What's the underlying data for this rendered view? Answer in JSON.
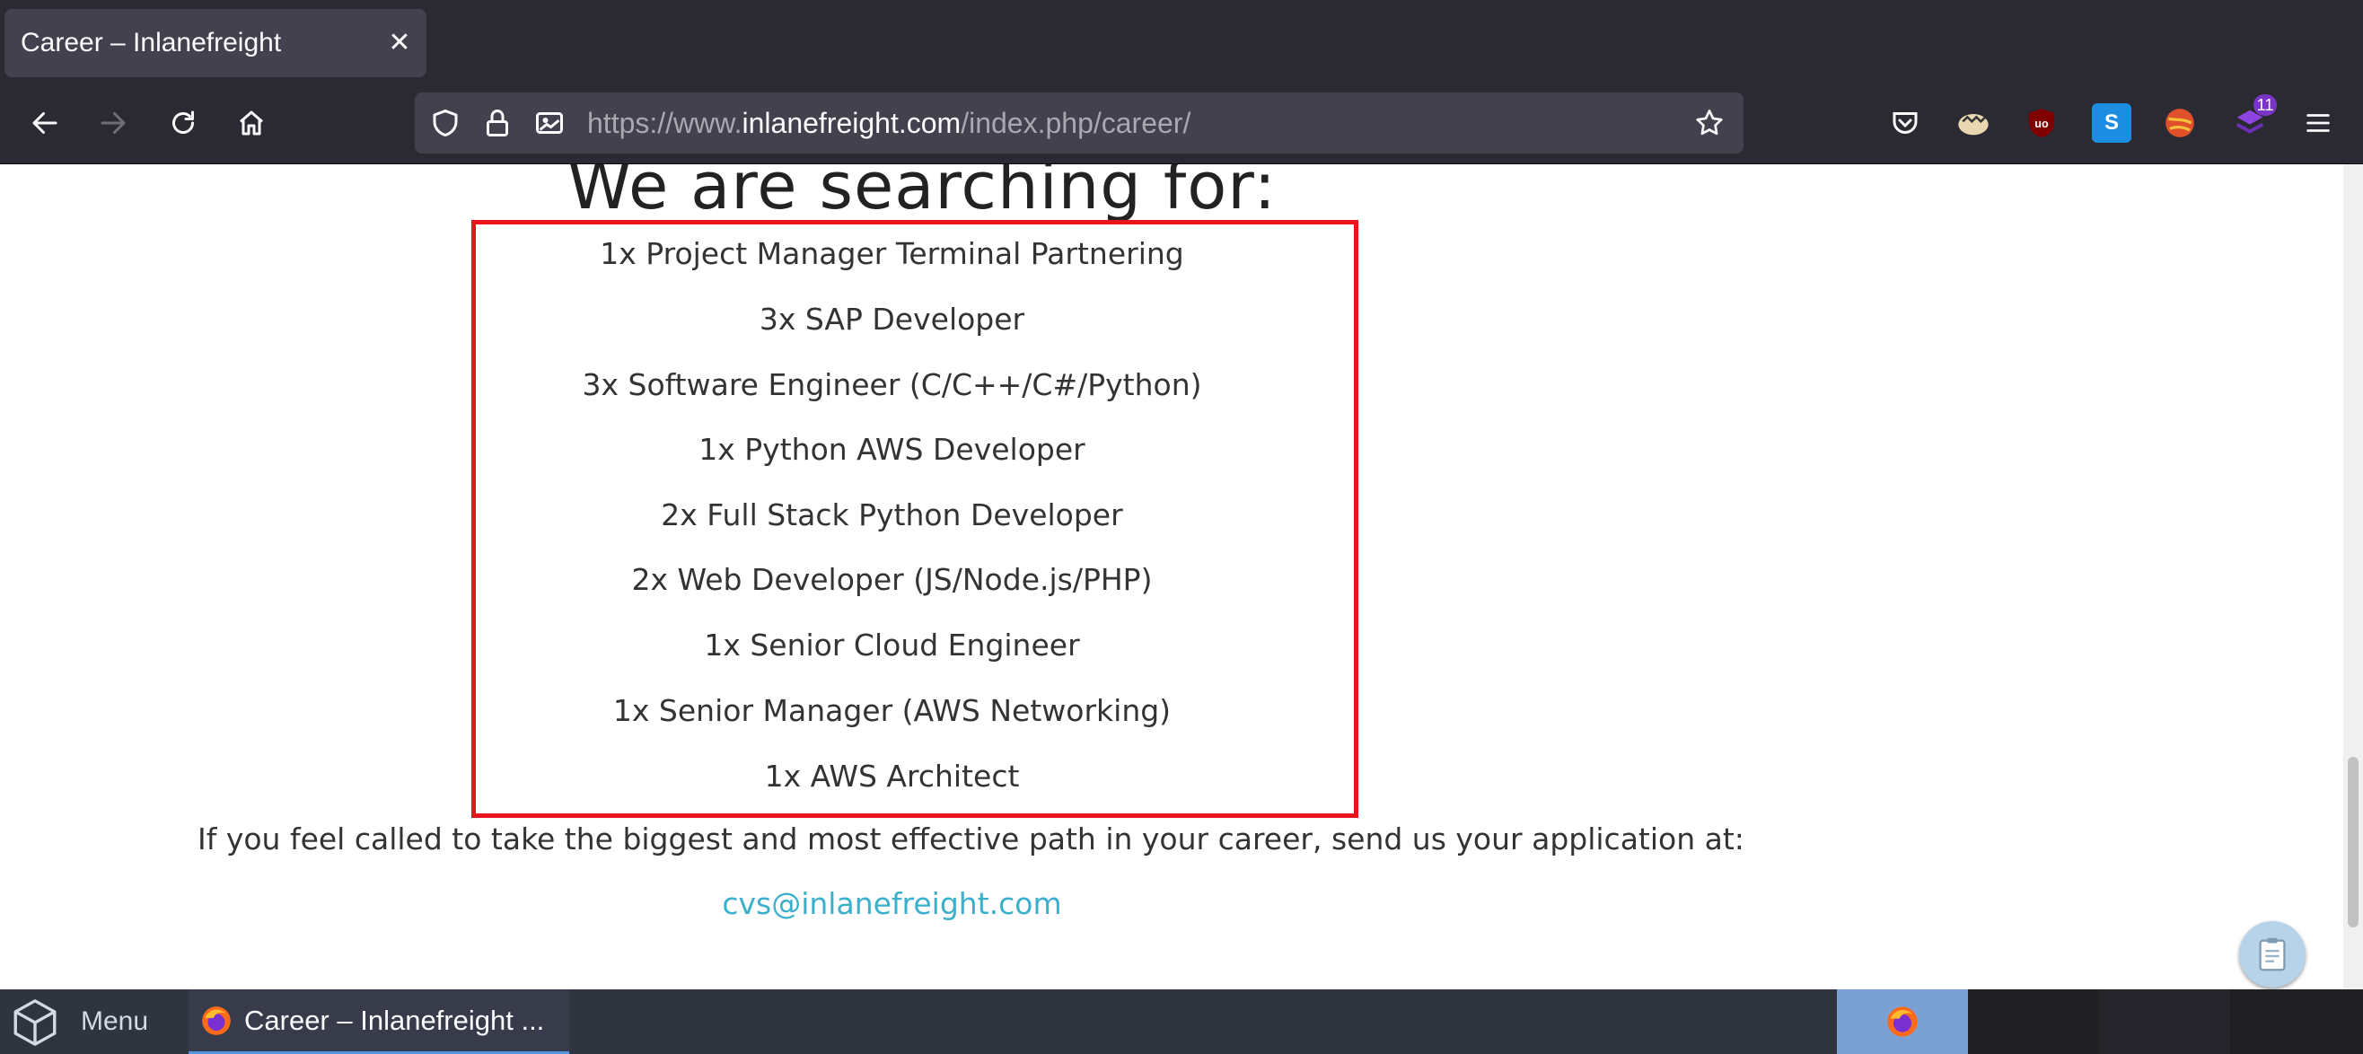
{
  "browser": {
    "tab_title": "Career – Inlanefreight",
    "url_prefix": "https://www.",
    "url_domain": "inlanefreight.com",
    "url_path": "/index.php/career/",
    "extension_badge": "11"
  },
  "page": {
    "heading": "We are searching for:",
    "jobs": [
      "1x Project Manager Terminal Partnering",
      "3x SAP Developer",
      "3x Software Engineer (C/C++/C#/Python)",
      "1x Python AWS Developer",
      "2x Full Stack Python Developer",
      "2x Web Developer (JS/Node.js/PHP)",
      "1x Senior Cloud Engineer",
      "1x Senior Manager (AWS Networking)",
      "1x AWS Architect"
    ],
    "cta": "If you feel called to take the biggest and most effective path in your career, send us your application at:",
    "email": "cvs@inlanefreight.com"
  },
  "taskbar": {
    "menu_label": "Menu",
    "window_label": "Career – Inlanefreight ..."
  },
  "colors": {
    "highlight_box": "#e8141b",
    "link": "#3bb0cc"
  }
}
